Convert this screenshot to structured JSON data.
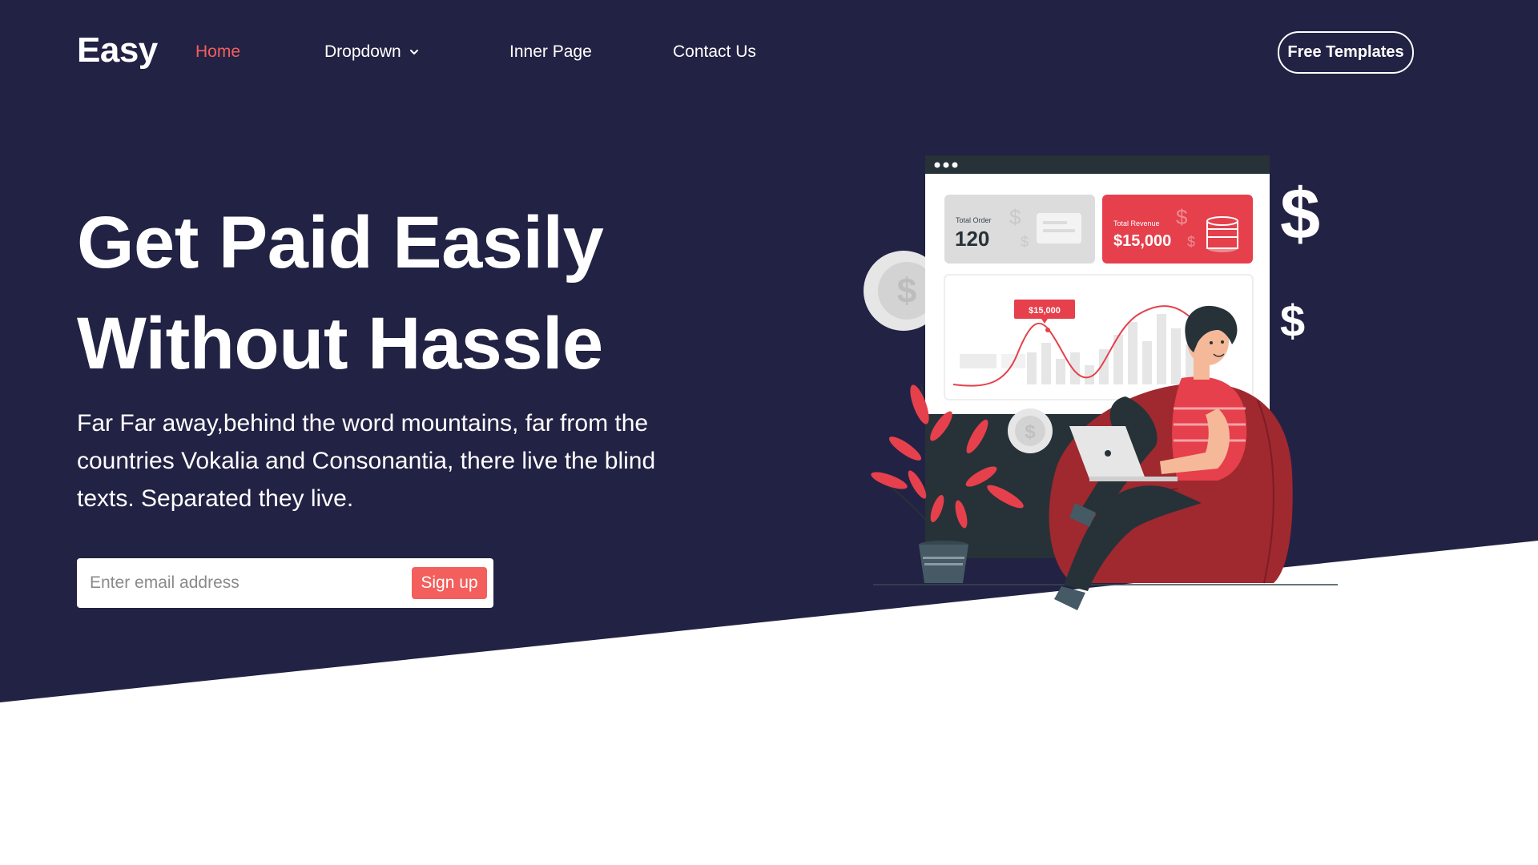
{
  "brand": {
    "logo": "Easy"
  },
  "nav": {
    "items": [
      {
        "label": "Home",
        "active": true
      },
      {
        "label": "Dropdown",
        "active": false
      },
      {
        "label": "Inner Page",
        "active": false
      },
      {
        "label": "Contact Us",
        "active": false
      }
    ],
    "cta_label": "Free Templates"
  },
  "hero": {
    "title_line1": "Get Paid Easily",
    "title_line2": "Without Hassle",
    "subtitle": "Far Far away,behind the word mountains, far from the countries Vokalia and Consonantia, there live the blind texts. Separated they live."
  },
  "signup": {
    "placeholder": "Enter email address",
    "button_label": "Sign up"
  },
  "illustration": {
    "order_label": "Total Order",
    "order_value": "120",
    "revenue_label": "Total Revenue",
    "revenue_value": "$15,000",
    "chart_tooltip": "$15,000",
    "currency_symbol": "$"
  },
  "colors": {
    "hero_background": "#222244",
    "accent": "#f25f5c",
    "text_light": "#ffffff"
  },
  "icons": [
    "chevron-down-icon",
    "dollar-icon",
    "coin-icon",
    "coins-stack-icon",
    "laptop-icon",
    "plant-icon"
  ]
}
